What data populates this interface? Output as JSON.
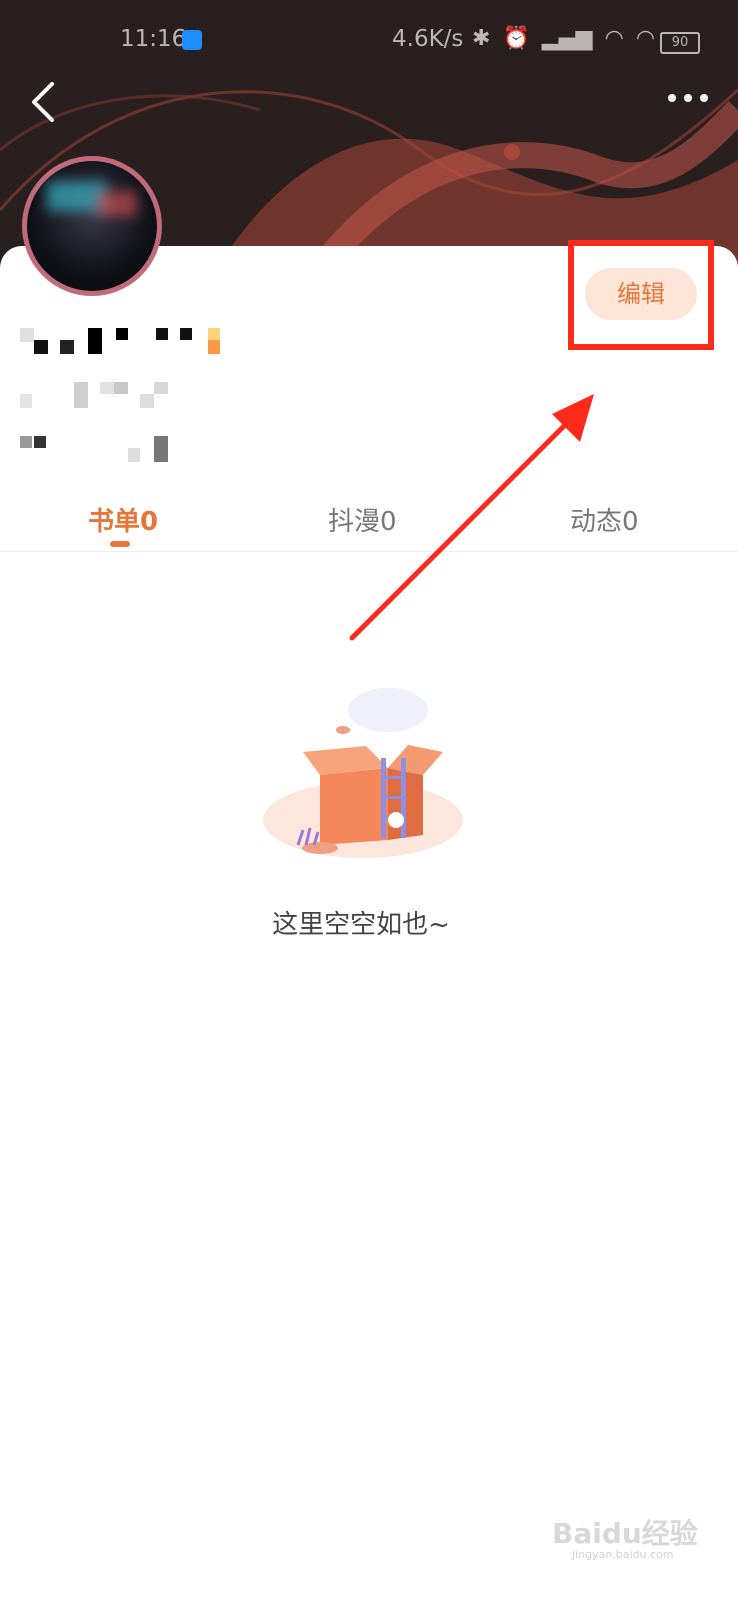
{
  "status_bar": {
    "time": "11:16",
    "network_speed": "4.6K/s",
    "battery": "90"
  },
  "header": {
    "back_icon": "chevron-left-icon",
    "more_icon": "more-dots-icon"
  },
  "profile": {
    "edit_label": "编辑"
  },
  "tabs": [
    {
      "label": "书单0",
      "active": true
    },
    {
      "label": "抖漫0",
      "active": false
    },
    {
      "label": "动态0",
      "active": false
    }
  ],
  "empty_state": {
    "text": "这里空空如也~"
  },
  "watermark": {
    "brand": "Baidu经验",
    "url": "jingyan.baidu.com"
  },
  "colors": {
    "accent": "#e8753a",
    "highlight": "#ff2a1a",
    "header_bg": "#2a1f1f"
  }
}
